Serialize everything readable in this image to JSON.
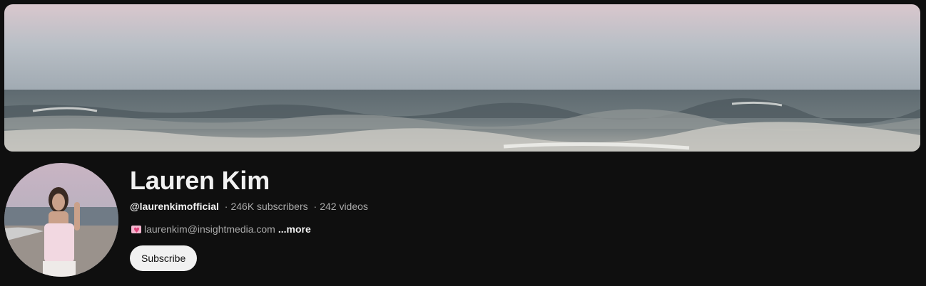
{
  "channel": {
    "name": "Lauren Kim",
    "handle": "@laurenkimofficial",
    "subscribers": "246K subscribers",
    "videos": "242 videos",
    "separator": "·",
    "description": "laurenkim@insightmedia.com",
    "more_label": "...more",
    "subscribe_label": "Subscribe"
  },
  "icons": {
    "description_icon": "heart-letter-icon"
  },
  "colors": {
    "background": "#0f0f0f",
    "subscribe_bg": "#f1f1f1",
    "secondary_text": "#aaaaaa"
  }
}
